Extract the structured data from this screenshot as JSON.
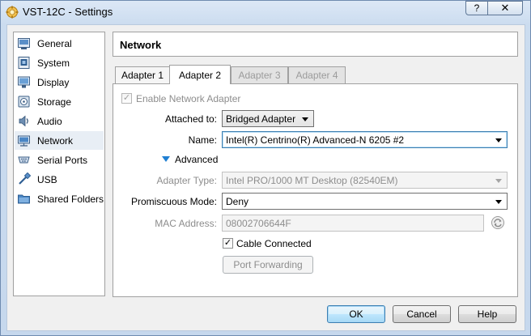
{
  "window": {
    "title": "VST-12C - Settings",
    "help_glyph": "?",
    "close_glyph": "✕"
  },
  "sidebar": {
    "items": [
      {
        "label": "General",
        "icon": "general-icon"
      },
      {
        "label": "System",
        "icon": "system-icon"
      },
      {
        "label": "Display",
        "icon": "display-icon"
      },
      {
        "label": "Storage",
        "icon": "storage-icon"
      },
      {
        "label": "Audio",
        "icon": "audio-icon"
      },
      {
        "label": "Network",
        "icon": "network-icon",
        "selected": true
      },
      {
        "label": "Serial Ports",
        "icon": "serial-ports-icon"
      },
      {
        "label": "USB",
        "icon": "usb-icon"
      },
      {
        "label": "Shared Folders",
        "icon": "shared-folders-icon"
      }
    ]
  },
  "page": {
    "title": "Network"
  },
  "tabs": [
    {
      "label": "Adapter 1",
      "state": "normal"
    },
    {
      "label": "Adapter 2",
      "state": "active"
    },
    {
      "label": "Adapter 3",
      "state": "disabled"
    },
    {
      "label": "Adapter 4",
      "state": "disabled"
    }
  ],
  "adapter": {
    "enable_label": "Enable Network Adapter",
    "enable_checked": true,
    "attached_label": "Attached to:",
    "attached_value": "Bridged Adapter",
    "name_label": "Name:",
    "name_value": "Intel(R) Centrino(R) Advanced-N 6205 #2",
    "advanced_label": "Advanced",
    "adapter_type_label": "Adapter Type:",
    "adapter_type_value": "Intel PRO/1000 MT Desktop (82540EM)",
    "promiscuous_label": "Promiscuous Mode:",
    "promiscuous_value": "Deny",
    "mac_label": "MAC Address:",
    "mac_value": "08002706644F",
    "cable_label": "Cable Connected",
    "cable_checked": true,
    "port_forwarding_label": "Port Forwarding",
    "check_glyph": "✓"
  },
  "footer": {
    "ok": "OK",
    "cancel": "Cancel",
    "help": "Help"
  },
  "colors": {
    "accent": "#3c7fb1",
    "advanced_triangle": "#1f7fd2",
    "window_frame": "#c6d8ed"
  }
}
